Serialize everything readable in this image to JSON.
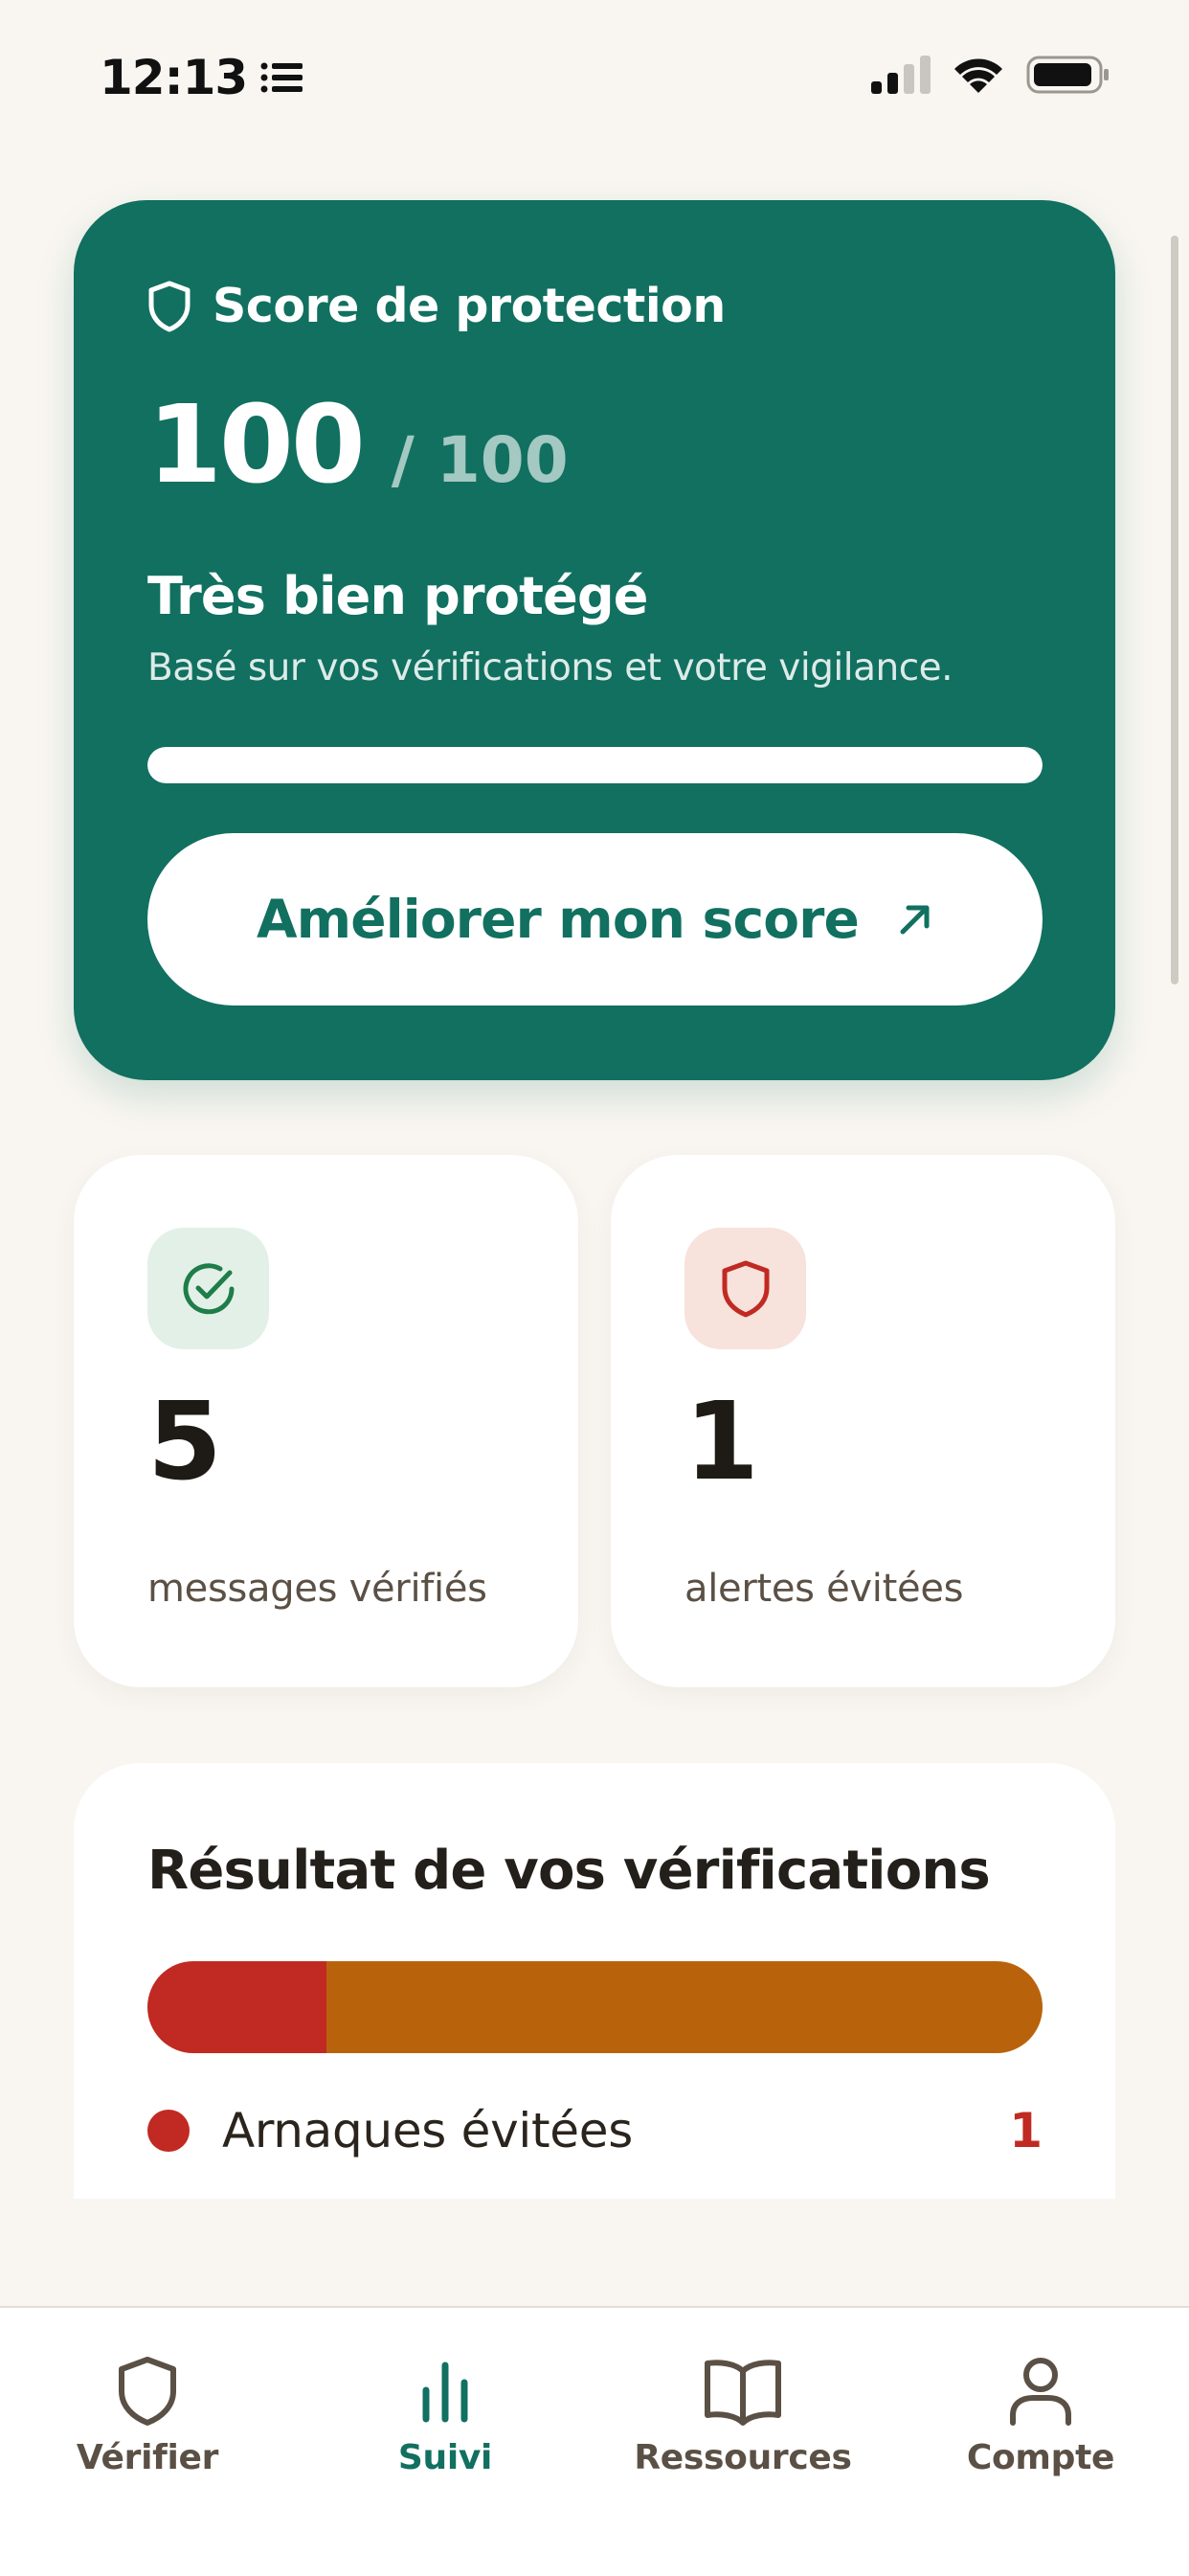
{
  "status_bar": {
    "time": "12:13"
  },
  "score_card": {
    "title": "Score de protection",
    "score": "100",
    "max": "/ 100",
    "status": "Très bien protégé",
    "description": "Basé sur vos vérifications et votre vigilance.",
    "progress": 1.0,
    "button_label": "Améliorer mon score"
  },
  "stats": {
    "verified": {
      "value": "5",
      "label": "messages vérifiés"
    },
    "alerts": {
      "value": "1",
      "label": "alertes évitées"
    }
  },
  "results": {
    "title": "Résultat de vos vérifications",
    "segments": [
      {
        "fraction": 0.2,
        "color": "#c02a22"
      },
      {
        "fraction": 0.8,
        "color": "#b8630c"
      }
    ],
    "rows": [
      {
        "label": "Arnaques évitées",
        "count": "1",
        "color": "#c02a22"
      }
    ]
  },
  "tabs": [
    {
      "label": "Vérifier",
      "icon": "shield-icon",
      "active": false
    },
    {
      "label": "Suivi",
      "icon": "bar-chart-icon",
      "active": true
    },
    {
      "label": "Ressources",
      "icon": "book-icon",
      "active": false
    },
    {
      "label": "Compte",
      "icon": "person-icon",
      "active": false
    }
  ],
  "colors": {
    "brand": "#117060",
    "background": "#f9f6f1",
    "danger": "#c02a22",
    "warning": "#b8630c",
    "success_tint": "#e3f0e8",
    "danger_tint": "#f7e2dc"
  }
}
